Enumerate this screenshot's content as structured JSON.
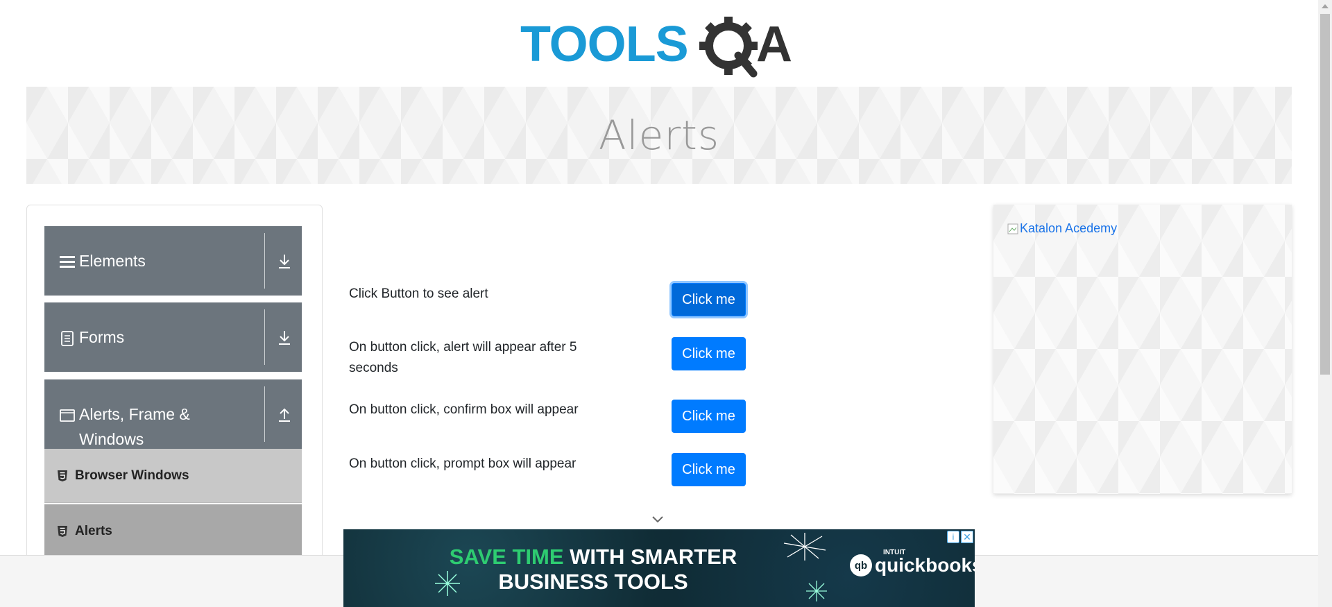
{
  "brand": {
    "logo_text": "TOOLSQA",
    "logo_colors": {
      "tools": "#1a9ad6",
      "qa": "#333333"
    }
  },
  "banner": {
    "title": "Alerts"
  },
  "nav": {
    "groups": [
      {
        "label": "Elements",
        "icon": "hamburger-icon",
        "state": "collapsed"
      },
      {
        "label": "Forms",
        "icon": "document-icon",
        "state": "collapsed"
      },
      {
        "label": "Alerts, Frame & Windows",
        "label_line1": "Alerts, Frame &",
        "label_line2": "Windows",
        "icon": "window-icon",
        "state": "expanded"
      }
    ],
    "items": [
      {
        "label": "Browser Windows",
        "icon": "html5-icon"
      },
      {
        "label": "Alerts",
        "icon": "html5-icon",
        "active": true
      }
    ]
  },
  "main": {
    "rows": [
      {
        "text": "Click Button to see alert",
        "button": "Click me"
      },
      {
        "text_line1": "On button click, alert will appear after 5",
        "text_line2": "seconds",
        "button": "Click me"
      },
      {
        "text": "On button click, confirm box will appear",
        "button": "Click me"
      },
      {
        "text": "On button click, prompt box will appear",
        "button": "Click me"
      }
    ]
  },
  "sidead": {
    "alt_text": "Katalon Acedemy"
  },
  "bottomad": {
    "headline_green": "SAVE TIME",
    "headline_white": "WITH SMARTER",
    "line2": "BUSINESS TOOLS",
    "brand_small": "INTUIT",
    "brand_name": "quickbooks",
    "brand_logo": "qb",
    "info_icon": "i",
    "close_icon": "✕"
  },
  "colors": {
    "primary_button": "#007bff",
    "nav_group_bg": "#6c757d",
    "nav_item_bg": "#c8c8c8",
    "nav_item_active_bg": "#a8a8a8",
    "ad_bg": "#0f2a33"
  }
}
